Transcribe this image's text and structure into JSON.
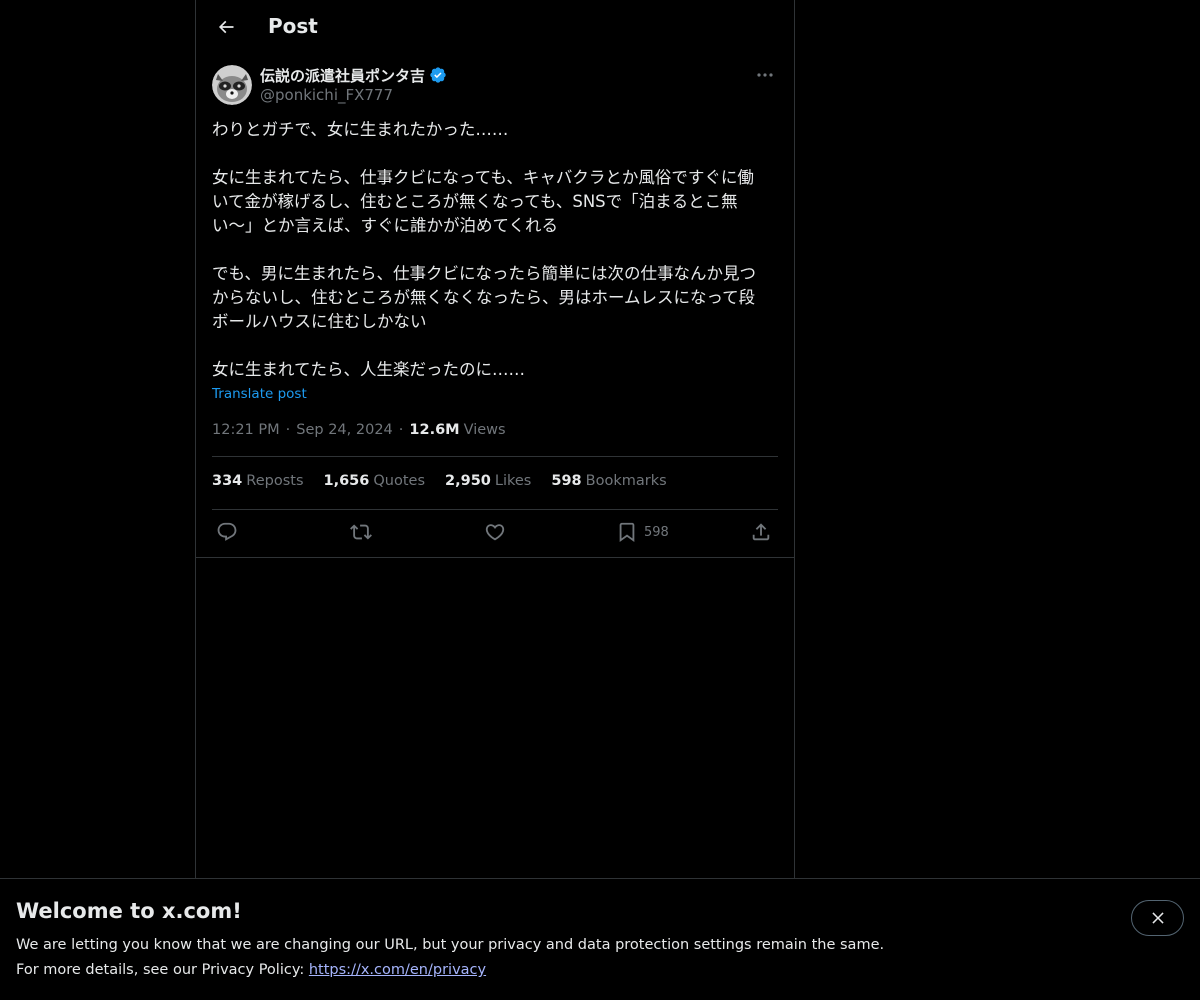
{
  "header": {
    "title": "Post"
  },
  "author": {
    "display_name": "伝説の派遣社員ポンタ吉",
    "handle": "@ponkichi_FX777"
  },
  "post": {
    "text": "わりとガチで、女に生まれたかった……\n\n女に生まれてたら、仕事クビになっても、キャバクラとか風俗ですぐに働\nいて金が稼げるし、住むところが無くなっても、SNSで「泊まるとこ無\nい〜」とか言えば、すぐに誰かが泊めてくれる\n\nでも、男に生まれたら、仕事クビになったら簡単には次の仕事なんか見つ\nからないし、住むところが無くなくなったら、男はホームレスになって段\nボールハウスに住むしかない\n\n女に生まれてたら、人生楽だったのに……",
    "translate_label": "Translate post",
    "time": "12:21 PM",
    "date": "Sep 24, 2024",
    "views_count": "12.6M",
    "views_label": "Views",
    "separator": "·"
  },
  "stats": {
    "reposts_count": "334",
    "reposts_label": "Reposts",
    "quotes_count": "1,656",
    "quotes_label": "Quotes",
    "likes_count": "2,950",
    "likes_label": "Likes",
    "bookmarks_count": "598",
    "bookmarks_label": "Bookmarks"
  },
  "actions": {
    "bookmark_count": "598"
  },
  "banner": {
    "title": "Welcome to x.com!",
    "line1": "We are letting you know that we are changing our URL, but your privacy and data protection settings remain the same.",
    "line2_prefix": "For more details, see our Privacy Policy: ",
    "link": "https://x.com/en/privacy"
  },
  "colors": {
    "background": "#000000",
    "text": "#e7e9ea",
    "muted": "#71767b",
    "accent": "#1d9bf0",
    "border": "#2f3336"
  },
  "icons": [
    "arrow-left-icon",
    "verified-badge-icon",
    "more-horizontal-icon",
    "reply-icon",
    "repost-icon",
    "like-icon",
    "bookmark-icon",
    "share-icon",
    "close-icon"
  ]
}
